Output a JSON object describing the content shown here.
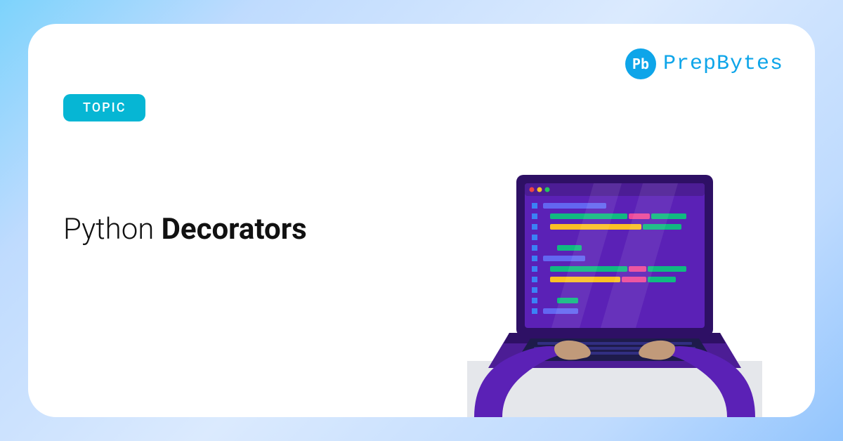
{
  "brand": {
    "icon_text": "Pb",
    "name": "PrepBytes"
  },
  "badge": {
    "label": "TOPIC"
  },
  "title": {
    "light": "Python ",
    "bold": "Decorators"
  },
  "colors": {
    "accent": "#06b6d4",
    "brand": "#0ea5e9"
  }
}
